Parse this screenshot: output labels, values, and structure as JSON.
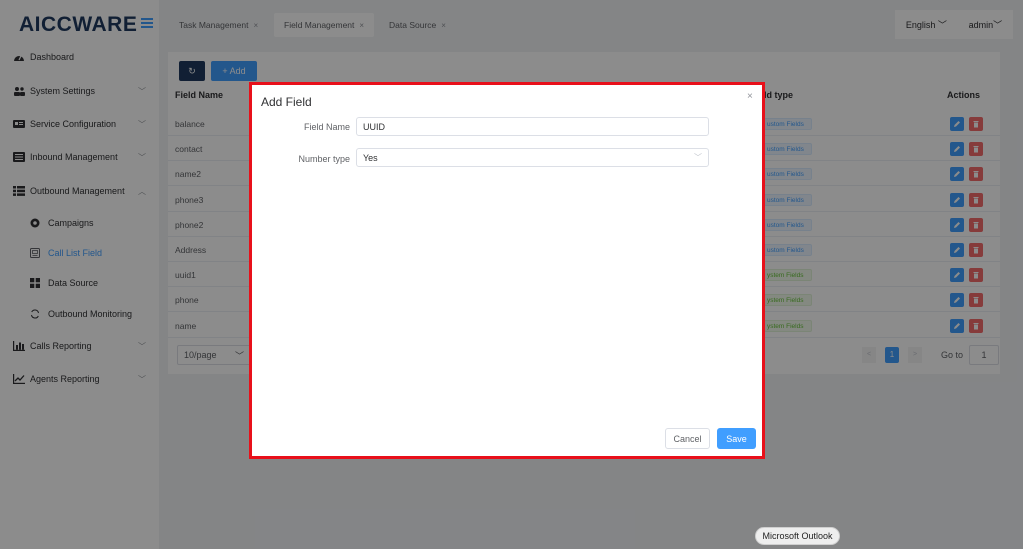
{
  "brand": {
    "logo": "AICCWARE"
  },
  "sidebar": {
    "items": [
      {
        "label": "Dashboard",
        "icon": "tachometer-icon"
      },
      {
        "label": "System Settings",
        "icon": "users-icon"
      },
      {
        "label": "Service Configuration",
        "icon": "id-card-icon"
      },
      {
        "label": "Inbound Management",
        "icon": "list-icon"
      },
      {
        "label": "Outbound Management",
        "icon": "list-icon"
      },
      {
        "label": "Calls Reporting",
        "icon": "bar-chart-icon"
      },
      {
        "label": "Agents Reporting",
        "icon": "line-chart-icon"
      }
    ],
    "sub_items": [
      {
        "label": "Campaigns",
        "icon": "chrome-icon"
      },
      {
        "label": "Call List Field",
        "icon": "form-icon"
      },
      {
        "label": "Data Source",
        "icon": "grid-icon"
      },
      {
        "label": "Outbound Monitoring",
        "icon": "sync-icon"
      }
    ]
  },
  "tabs": [
    {
      "label": "Task Management"
    },
    {
      "label": "Field Management"
    },
    {
      "label": "Data Source"
    }
  ],
  "header": {
    "language": "English",
    "user": "admin"
  },
  "toolbar": {
    "add_label": "+ Add"
  },
  "table": {
    "headers": {
      "name": "Field Name",
      "type": "ld type",
      "actions": "Actions"
    },
    "rows": [
      {
        "name": "balance",
        "type": "ustom Fields"
      },
      {
        "name": "contact",
        "type": "ustom Fields"
      },
      {
        "name": "name2",
        "type": "ustom Fields"
      },
      {
        "name": "phone3",
        "type": "ustom Fields"
      },
      {
        "name": "phone2",
        "type": "ustom Fields"
      },
      {
        "name": "Address",
        "type": "ustom Fields"
      },
      {
        "name": "uuid1",
        "type": "ystem Fields"
      },
      {
        "name": "phone",
        "type": "ystem Fields"
      },
      {
        "name": "name",
        "type": "ystem Fields"
      }
    ]
  },
  "pagination": {
    "page_size": "10/page",
    "current_page": "1",
    "goto_label": "Go to",
    "goto_value": "1"
  },
  "dialog": {
    "title": "Add Field",
    "field_name_label": "Field Name",
    "field_name_value": "UUID",
    "number_type_label": "Number type",
    "number_type_value": "Yes",
    "cancel_label": "Cancel",
    "save_label": "Save"
  },
  "tooltip": {
    "text": "Microsoft Outlook"
  },
  "colors": {
    "accent": "#409eff",
    "brand_dark": "#1f3a5f",
    "danger": "#f56c6c",
    "highlight_border": "#e8101a"
  }
}
